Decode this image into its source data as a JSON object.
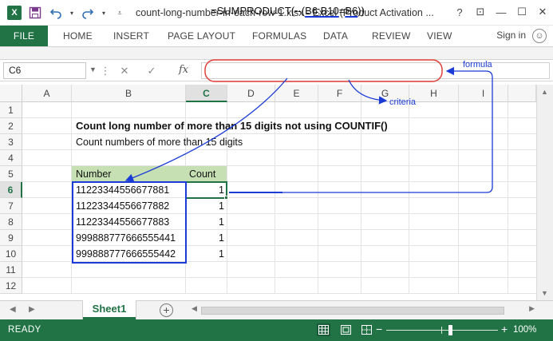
{
  "window": {
    "title": "count-long-number-in-each-row-1.xlsx - Excel (Product Activation ...",
    "logo_letter": "X",
    "qat_icons": [
      "save-icon",
      "undo-icon",
      "redo-icon",
      "customize-qat-icon"
    ],
    "controls": {
      "help": "?",
      "ribbon_display": "⊡",
      "minimize": "—",
      "maximize": "☐",
      "close": "✕"
    }
  },
  "ribbon": {
    "tabs": [
      "FILE",
      "HOME",
      "INSERT",
      "PAGE LAYOUT",
      "FORMULAS",
      "DATA",
      "REVIEW",
      "VIEW"
    ],
    "active_tab": "FILE",
    "signin": "Sign in"
  },
  "formula_bar": {
    "name_box": "C6",
    "fx_label": "fx",
    "formula_prefix": "=SUMPRODUCT(--(",
    "formula_range": "B6:B10",
    "formula_op": "=",
    "formula_criteria": "B6",
    "formula_suffix": "))"
  },
  "grid": {
    "columns": [
      "A",
      "B",
      "C",
      "D",
      "E",
      "F",
      "G",
      "H",
      "I"
    ],
    "active_column": "C",
    "rows": [
      "1",
      "2",
      "3",
      "4",
      "5",
      "6",
      "7",
      "8",
      "9",
      "10",
      "11",
      "12"
    ],
    "active_row": "6",
    "cells": {
      "B2": "Count long number of more than 15 digits not using COUNTIF()",
      "B3": "Count numbers of more than 15 digits",
      "B5": "Number",
      "C5": "Count",
      "B6": "11223344556677881",
      "B7": "11223344556677882",
      "B8": "11223344556677883",
      "B9": "999888777666555441",
      "B10": "999888777666555442",
      "C6": "1",
      "C7": "1",
      "C8": "1",
      "C9": "1",
      "C10": "1"
    }
  },
  "annotations": {
    "formula_label": "formula",
    "criteria_label": "criteria",
    "color": "#1b3bd6",
    "formula_circle_color": "#e0403a"
  },
  "sheets": {
    "tabs": [
      "Sheet1"
    ],
    "active": "Sheet1",
    "add_label": "+"
  },
  "status_bar": {
    "status": "READY",
    "zoom": "100%",
    "zoom_minus": "−",
    "zoom_plus": "+"
  }
}
